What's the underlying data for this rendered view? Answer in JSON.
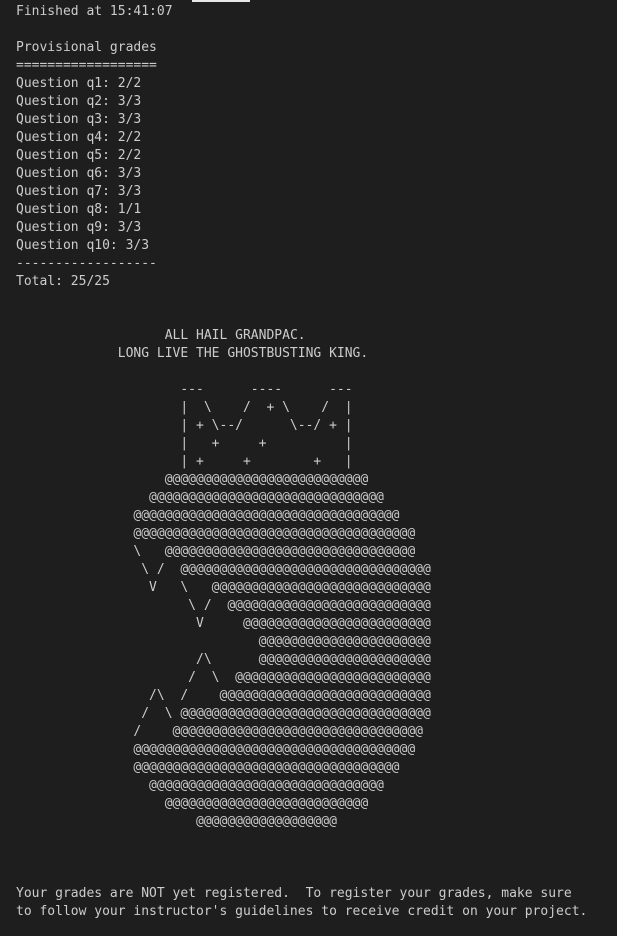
{
  "terminal": {
    "finished_line": "Finished at 15:41:07",
    "provisional_heading": "Provisional grades",
    "heading_rule": "==================",
    "questions": [
      "Question q1: 2/2",
      "Question q2: 3/3",
      "Question q3: 3/3",
      "Question q4: 2/2",
      "Question q5: 2/2",
      "Question q6: 3/3",
      "Question q7: 3/3",
      "Question q8: 1/1",
      "Question q9: 3/3",
      "Question q10: 3/3"
    ],
    "total_rule": "------------------",
    "total_line": "Total: 25/25",
    "hail_line_1": "ALL HAIL GRANDPAC.",
    "hail_line_2": "LONG LIVE THE GHOSTBUSTING KING.",
    "ascii_art": "                     ---      ----      ---\n                     |  \\    /  + \\    /  |\n                     | + \\--/      \\--/ + |\n                     |   +     +          |\n                     | +     +        +   |\n                   @@@@@@@@@@@@@@@@@@@@@@@@@@\n                 @@@@@@@@@@@@@@@@@@@@@@@@@@@@@@\n               @@@@@@@@@@@@@@@@@@@@@@@@@@@@@@@@@@\n               @@@@@@@@@@@@@@@@@@@@@@@@@@@@@@@@@@@@\n               \\   @@@@@@@@@@@@@@@@@@@@@@@@@@@@@@@@\n                \\ /  @@@@@@@@@@@@@@@@@@@@@@@@@@@@@@@@\n                 V   \\   @@@@@@@@@@@@@@@@@@@@@@@@@@@@\n                      \\ /  @@@@@@@@@@@@@@@@@@@@@@@@@@\n                       V     @@@@@@@@@@@@@@@@@@@@@@@@\n                               @@@@@@@@@@@@@@@@@@@@@@\n                       /\\      @@@@@@@@@@@@@@@@@@@@@@\n                      /  \\  @@@@@@@@@@@@@@@@@@@@@@@@@\n                 /\\  /    @@@@@@@@@@@@@@@@@@@@@@@@@@@\n                /  \\ @@@@@@@@@@@@@@@@@@@@@@@@@@@@@@@@\n               /    @@@@@@@@@@@@@@@@@@@@@@@@@@@@@@@@\n               @@@@@@@@@@@@@@@@@@@@@@@@@@@@@@@@@@@@\n               @@@@@@@@@@@@@@@@@@@@@@@@@@@@@@@@@@\n                 @@@@@@@@@@@@@@@@@@@@@@@@@@@@@@\n                   @@@@@@@@@@@@@@@@@@@@@@@@@@\n                       @@@@@@@@@@@@@@@@@@",
    "footer_line_1": "Your grades are NOT yet registered.  To register your grades, make sure",
    "footer_line_2": "to follow your instructor's guidelines to receive credit on your project."
  },
  "colors": {
    "background": "#1e1e1e",
    "text": "#cccccc"
  }
}
